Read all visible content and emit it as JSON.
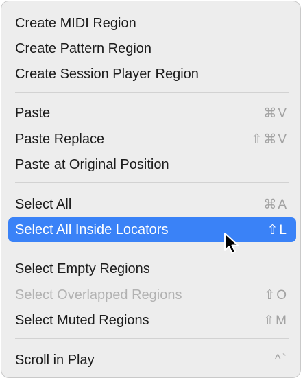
{
  "menu": {
    "items": [
      {
        "label": "Create MIDI Region",
        "shortcut": ""
      },
      {
        "label": "Create Pattern Region",
        "shortcut": ""
      },
      {
        "label": "Create Session Player Region",
        "shortcut": ""
      },
      {
        "label": "Paste",
        "shortcut": "⌘V"
      },
      {
        "label": "Paste Replace",
        "shortcut": "⇧⌘V"
      },
      {
        "label": "Paste at Original Position",
        "shortcut": ""
      },
      {
        "label": "Select All",
        "shortcut": "⌘A"
      },
      {
        "label": "Select All Inside Locators",
        "shortcut": "⇧L",
        "state": "highlighted"
      },
      {
        "label": "Select Empty Regions",
        "shortcut": ""
      },
      {
        "label": "Select Overlapped Regions",
        "shortcut": "⇧O",
        "state": "disabled"
      },
      {
        "label": "Select Muted Regions",
        "shortcut": "⇧M"
      },
      {
        "label": "Scroll in Play",
        "shortcut": "^`"
      }
    ]
  },
  "colors": {
    "menu_background": "#ededed",
    "highlight": "#3a82f7",
    "disabled_text": "#b2b2b2",
    "separator": "#d2d2d2"
  },
  "icons": {
    "cursor": "mouse-pointer-icon"
  }
}
